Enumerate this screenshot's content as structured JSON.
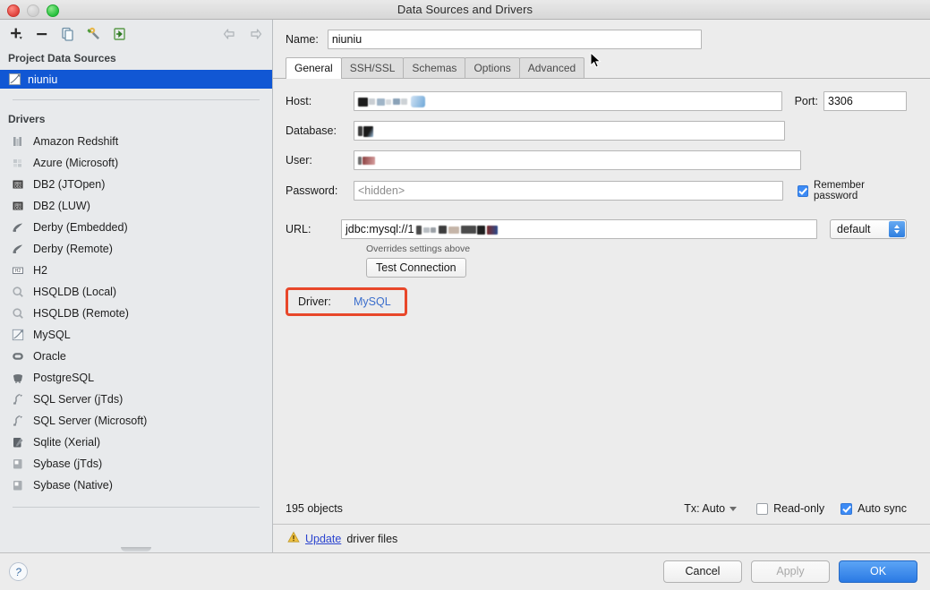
{
  "window": {
    "title": "Data Sources and Drivers",
    "traffic_lights": [
      "close-button",
      "minimize-button",
      "zoom-button"
    ]
  },
  "sidebar": {
    "toolbar": [
      {
        "name": "add-button",
        "icon": "plus-icon"
      },
      {
        "name": "remove-button",
        "icon": "minus-icon"
      },
      {
        "name": "copy-button",
        "icon": "copy-icon"
      },
      {
        "name": "tools-button",
        "icon": "wrench-icon"
      },
      {
        "name": "import-button",
        "icon": "import-icon"
      },
      {
        "name": "back-button",
        "icon": "arrow-left-icon"
      },
      {
        "name": "forward-button",
        "icon": "arrow-right-icon"
      }
    ],
    "project_header": "Project Data Sources",
    "data_sources": [
      {
        "label": "niuniu",
        "icon": "mysql-icon",
        "selected": true
      }
    ],
    "drivers_header": "Drivers",
    "drivers": [
      {
        "label": "Amazon Redshift",
        "icon": "redshift-icon"
      },
      {
        "label": "Azure (Microsoft)",
        "icon": "azure-icon"
      },
      {
        "label": "DB2 (JTOpen)",
        "icon": "db2-icon"
      },
      {
        "label": "DB2 (LUW)",
        "icon": "db2-icon"
      },
      {
        "label": "Derby (Embedded)",
        "icon": "derby-icon"
      },
      {
        "label": "Derby (Remote)",
        "icon": "derby-icon"
      },
      {
        "label": "H2",
        "icon": "h2-icon"
      },
      {
        "label": "HSQLDB (Local)",
        "icon": "hsqldb-icon"
      },
      {
        "label": "HSQLDB (Remote)",
        "icon": "hsqldb-icon"
      },
      {
        "label": "MySQL",
        "icon": "mysql-icon"
      },
      {
        "label": "Oracle",
        "icon": "oracle-icon"
      },
      {
        "label": "PostgreSQL",
        "icon": "postgresql-icon"
      },
      {
        "label": "SQL Server (jTds)",
        "icon": "sqlserver-icon"
      },
      {
        "label": "SQL Server (Microsoft)",
        "icon": "sqlserver-icon"
      },
      {
        "label": "Sqlite (Xerial)",
        "icon": "sqlite-icon"
      },
      {
        "label": "Sybase (jTds)",
        "icon": "sybase-icon"
      },
      {
        "label": "Sybase (Native)",
        "icon": "sybase-icon"
      }
    ]
  },
  "main": {
    "name_label": "Name:",
    "name_value": "niuniu",
    "tabs": [
      {
        "label": "General",
        "active": true
      },
      {
        "label": "SSH/SSL",
        "active": false
      },
      {
        "label": "Schemas",
        "active": false
      },
      {
        "label": "Options",
        "active": false
      },
      {
        "label": "Advanced",
        "active": false
      }
    ],
    "fields": {
      "host_label": "Host:",
      "host_value": "",
      "port_label": "Port:",
      "port_value": "3306",
      "database_label": "Database:",
      "database_value": "",
      "user_label": "User:",
      "user_value": "",
      "password_label": "Password:",
      "password_placeholder": "<hidden>",
      "remember_password_label": "Remember password",
      "remember_password_checked": true,
      "url_label": "URL:",
      "url_value": "jdbc:mysql://1",
      "url_hint": "Overrides settings above",
      "url_scheme_value": "default",
      "test_connection_label": "Test Connection",
      "driver_label": "Driver:",
      "driver_value": "MySQL"
    },
    "status": {
      "objects": "195 objects",
      "tx_label": "Tx: Auto",
      "read_only_label": "Read-only",
      "read_only_checked": false,
      "auto_sync_label": "Auto sync",
      "auto_sync_checked": true
    },
    "warning": {
      "icon": "warning-icon",
      "link": "Update",
      "text": "driver files"
    }
  },
  "footer": {
    "help_label": "?",
    "cancel_label": "Cancel",
    "apply_label": "Apply",
    "apply_disabled": true,
    "ok_label": "OK"
  },
  "colors": {
    "selection_blue": "#1157d4",
    "accent_blue": "#3d8bf5",
    "highlight_red": "#e8472a",
    "link_blue": "#3b6ecc",
    "window_bg": "#ececec",
    "sidebar_bg": "#e8eaec"
  }
}
